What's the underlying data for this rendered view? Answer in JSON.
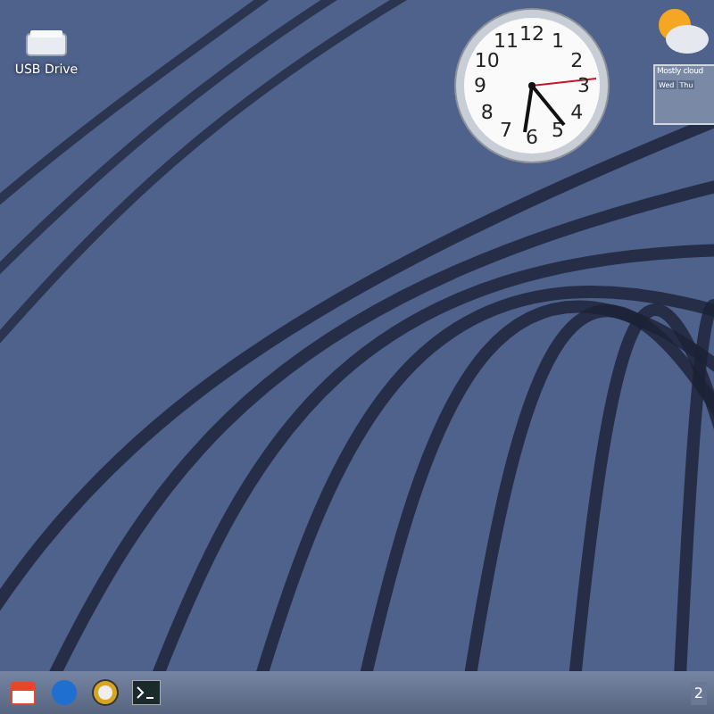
{
  "desktop_icons": [
    {
      "label": "USB Drive"
    }
  ],
  "clock_gadget": {
    "numerals": [
      "12",
      "11",
      "1",
      "10",
      "2",
      "9",
      "3",
      "8",
      "4",
      "7",
      "5",
      "6"
    ]
  },
  "weather_gadget": {
    "condition": "Mostly cloud",
    "days": [
      "Wed",
      "Thu"
    ]
  },
  "taskbar": {
    "tray_text": "2"
  }
}
